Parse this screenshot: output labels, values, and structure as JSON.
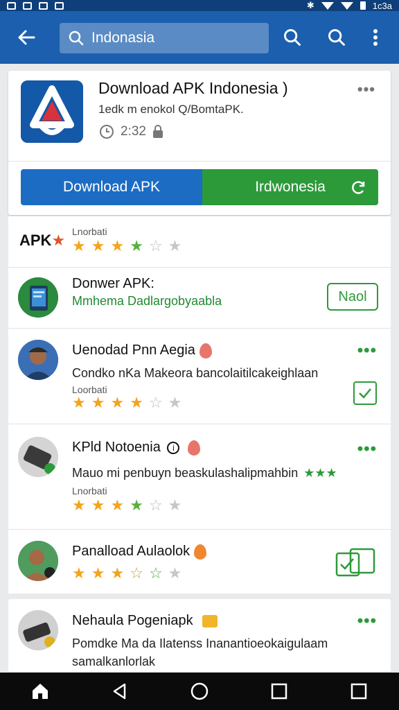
{
  "status_bar": {
    "time": "1c3a"
  },
  "app_bar": {
    "search": {
      "value": "Indonasia",
      "placeholder": "Indonasia"
    }
  },
  "featured": {
    "title": "Download APK Indonesia )",
    "subtitle": "1edk m enokol Q/BomtaPK.",
    "meta_time": "2:32",
    "download_label": "Download APK",
    "install_label": "Irdwonesia",
    "colors": {
      "blue": "#1c6cc4",
      "green": "#2d9a3a"
    }
  },
  "rows": [
    {
      "logo": "APK",
      "small_label": "Lnorbati",
      "rating": 3.5
    },
    {
      "title": "Donwer APK:",
      "subtitle": "Mmhema Dadlargobyaabla",
      "action_label": "Naol"
    },
    {
      "title": "Uenodad Pnn Aegia",
      "subtitle": "Condko nKa Makeora bancolaitilcakeighlaan",
      "small_label": "Loorbati",
      "rating": 3.5
    },
    {
      "title": "KPld Notoenia",
      "subtitle": "Mauo mi penbuyn beaskulashalipmahbin",
      "small_label": "Lnorbati",
      "rating": 3.5
    },
    {
      "title": "Panalload Aulaolok",
      "rating": 3.5
    },
    {
      "title": "Nehaula Pogeniapk",
      "subtitle": "Pomdke Ma da Ilatenss Inanantioeokaigulaam",
      "subtitle2": "samalkanlorlak"
    }
  ]
}
